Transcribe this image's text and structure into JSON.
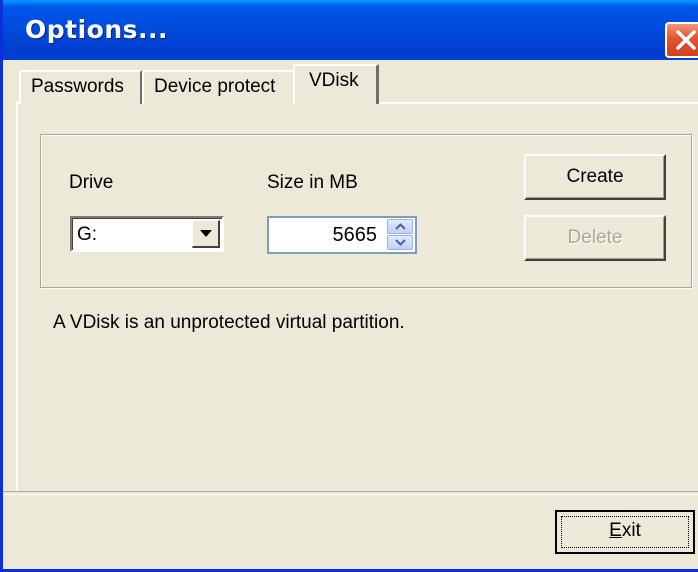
{
  "window": {
    "title": "Options...",
    "close_icon": "close-icon",
    "accent": "#0055ea",
    "close_color": "#d3401c"
  },
  "tabs": [
    {
      "label": "Passwords",
      "selected": false
    },
    {
      "label": "Device protect",
      "selected": false
    },
    {
      "label": "VDisk",
      "selected": true
    }
  ],
  "vdisk": {
    "drive_label": "Drive",
    "drive_value": "G:",
    "size_label": "Size in MB",
    "size_value": "5665",
    "create_label": "Create",
    "delete_label": "Delete",
    "description": "A VDisk is an unprotected virtual partition."
  },
  "footer": {
    "exit_mnemonic": "E",
    "exit_rest": "xit"
  }
}
